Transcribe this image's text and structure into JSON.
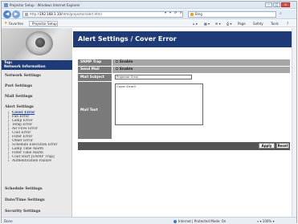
{
  "window": {
    "title": "Projector Setup - Windows Internet Explorer"
  },
  "browser": {
    "url_host": "192.168.1.10",
    "url_prefix": "http://",
    "url_path": "/html/projector/alert.html",
    "search_engine": "Bing",
    "tab_label": "Projector Setup",
    "favorites_label": "Favorites",
    "commands": [
      "Page",
      "Safety",
      "Tools"
    ],
    "status_left": "Done",
    "status_zone": "Internet | Protected Mode: On",
    "status_zoom": "100%"
  },
  "sidebar": {
    "top_label_line1": "Top:",
    "top_label_line2": "Network Information",
    "items": [
      "Network Settings",
      "Port Settings",
      "Mail Settings",
      "Alert Settings"
    ],
    "alert_subitems": [
      "Cover Error",
      "Fan Error",
      "Lamp Error",
      "Temp Error",
      "Air Flow Error",
      "Cold Error",
      "Filter Error",
      "Other Error",
      "Schedule Execution Error",
      "Lamp Time Alarm",
      "Filter Time Alarm",
      "Cold Start [SNMP Trap]",
      "Authentication Failure"
    ],
    "bottom_items": [
      "Schedule Settings",
      "Date/Time Settings",
      "Security Settings"
    ]
  },
  "main": {
    "title": "Alert Settings / Cover Error",
    "snmp_trap_label": "SNMP Trap",
    "snmp_trap_value": "Enable",
    "send_mail_label": "Send Mail",
    "send_mail_value": "Enable",
    "mail_subject_label": "Mail Subject",
    "mail_subject_value": "Projector Error",
    "mail_text_label": "Mail Text",
    "mail_text_value": "Cover Error!!",
    "apply_label": "Apply",
    "reset_label": "Reset"
  },
  "colors": {
    "header_bg": "#1f3b77",
    "label_bg": "#7a7a7a",
    "value_bg": "#a6a6a6"
  }
}
